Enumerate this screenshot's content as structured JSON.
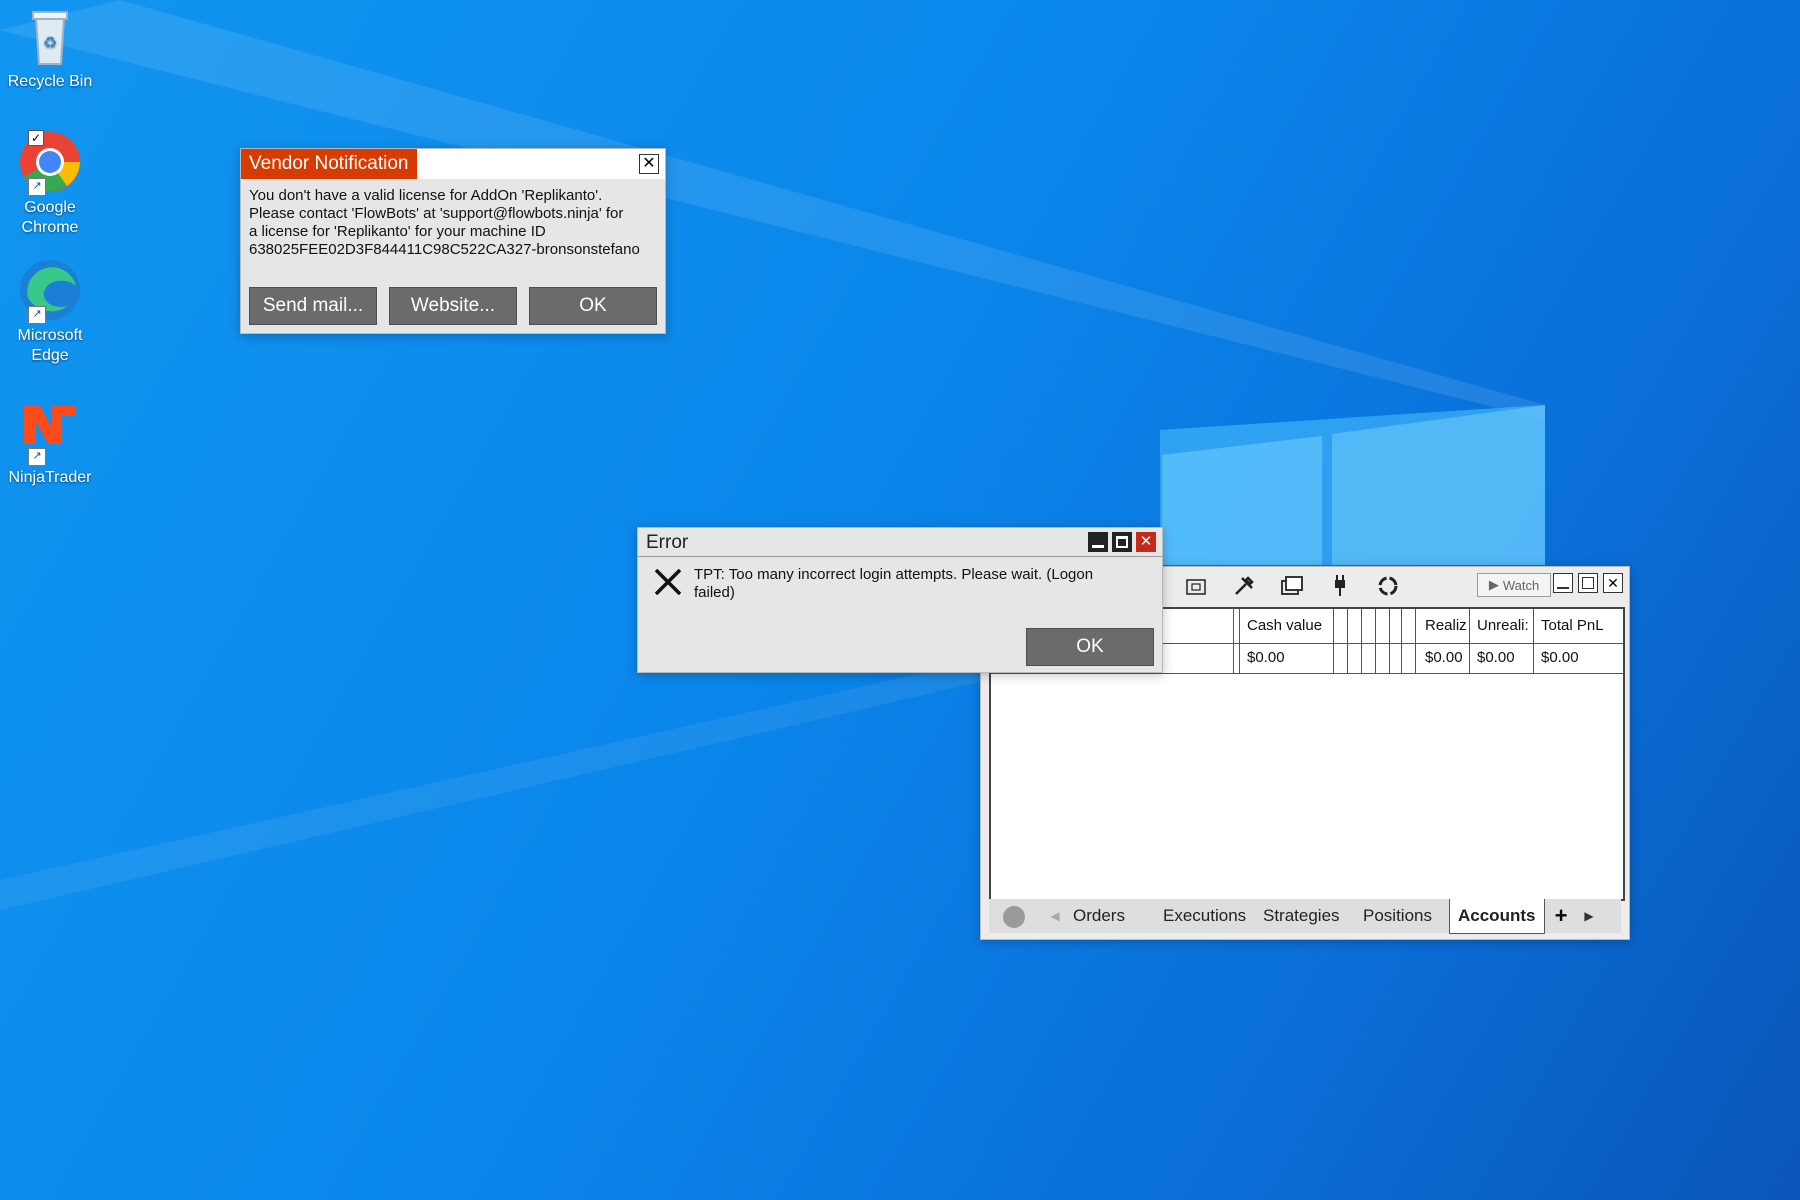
{
  "desktop": {
    "icons": [
      {
        "label": "Recycle Bin",
        "icon": "recycle-bin-icon"
      },
      {
        "label": "Google Chrome",
        "icon": "chrome-icon"
      },
      {
        "label": "Microsoft Edge",
        "icon": "edge-icon"
      },
      {
        "label": "NinjaTrader",
        "icon": "ninjatrader-icon"
      }
    ]
  },
  "vendor_dialog": {
    "title": "Vendor Notification",
    "message_lines": [
      "You don't have a valid license for AddOn 'Replikanto'.",
      "Please contact 'FlowBots' at 'support@flowbots.ninja' for",
      "a license for 'Replikanto' for your machine ID",
      "638025FEE02D3F844411C98C522CA327-bronsonstefano"
    ],
    "buttons": {
      "send_mail": "Send mail...",
      "website": "Website...",
      "ok": "OK"
    },
    "title_color": "#d83b01"
  },
  "error_dialog": {
    "title": "Error",
    "message_lines": [
      "TPT: Too many incorrect login attempts. Please wait. (Logon",
      "failed)"
    ],
    "ok": "OK",
    "close_color": "#c42b1c"
  },
  "accounts_window": {
    "watch_label": "Watch",
    "columns": [
      "Cash value",
      "Realiz",
      "Unreali:",
      "Total PnL"
    ],
    "row": [
      "$0.00",
      "$0.00",
      "$0.00",
      "$0.00"
    ],
    "tabs": [
      "Orders",
      "Executions",
      "Strategies",
      "Positions",
      "Accounts"
    ],
    "active_tab": "Accounts",
    "add_tab": "+"
  }
}
